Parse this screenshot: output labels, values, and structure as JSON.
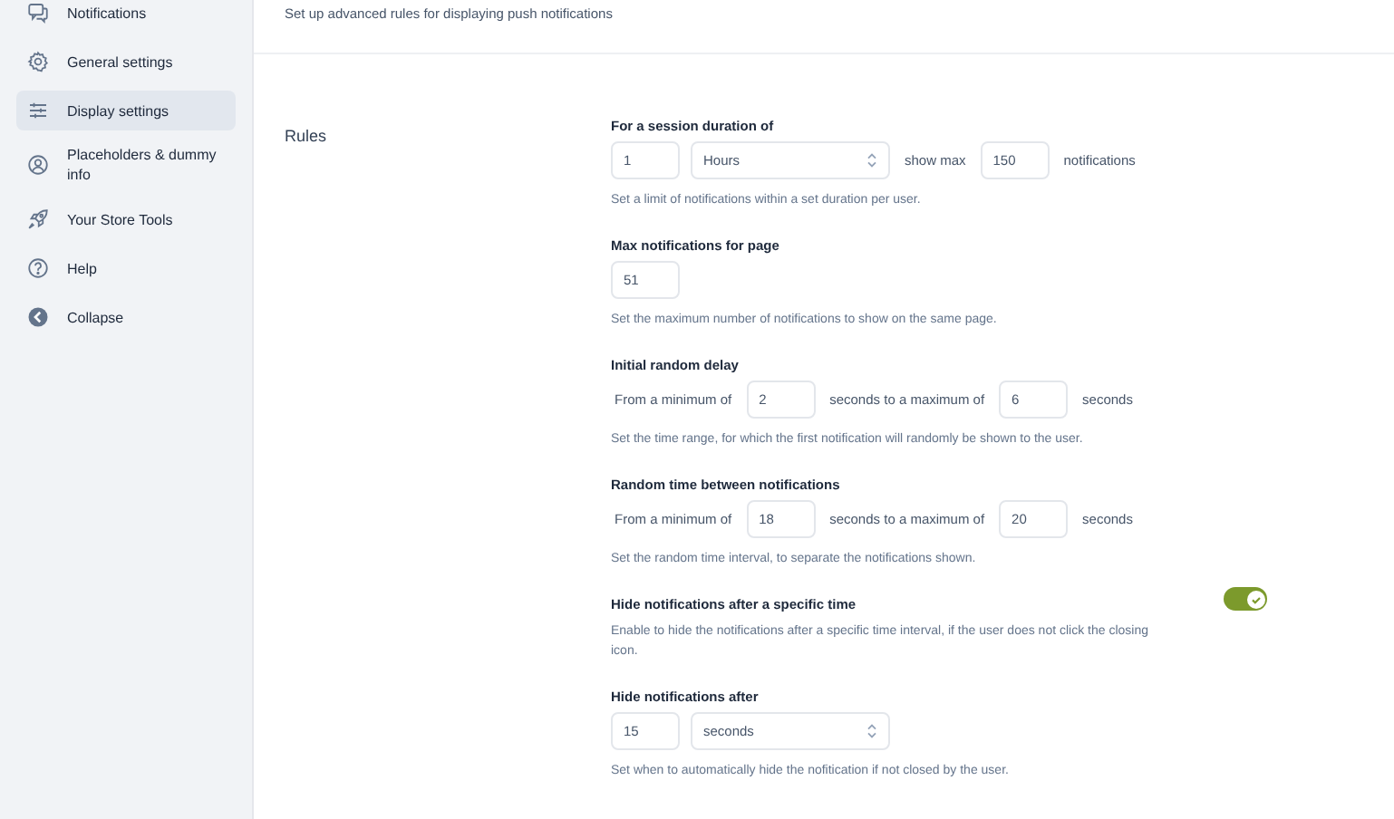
{
  "sidebar": {
    "items": [
      {
        "label": "Notifications",
        "selected": false
      },
      {
        "label": "General settings",
        "selected": false
      },
      {
        "label": "Display settings",
        "selected": true
      },
      {
        "label": "Placeholders & dummy info",
        "selected": false
      },
      {
        "label": "Your Store Tools",
        "selected": false
      },
      {
        "label": "Help",
        "selected": false
      },
      {
        "label": "Collapse",
        "selected": false
      }
    ]
  },
  "header": {
    "subtitle": "Set up advanced rules for displaying push notifications"
  },
  "section": {
    "title": "Rules",
    "settings": [
      {
        "kind": "fields",
        "title": "For a session duration of",
        "parts": [
          {
            "kind": "input",
            "value": "1"
          },
          {
            "kind": "select",
            "value": "Hours"
          },
          {
            "kind": "text",
            "text": "show max"
          },
          {
            "kind": "input",
            "value": "150"
          },
          {
            "kind": "text",
            "text": "notifications"
          }
        ],
        "help": "Set a limit of notifications within a set duration per user."
      },
      {
        "kind": "fields",
        "title": "Max notifications for page",
        "parts": [
          {
            "kind": "input",
            "value": "51"
          }
        ],
        "help": "Set the maximum number of notifications to show on the same page."
      },
      {
        "kind": "fields",
        "title": "Initial random delay",
        "parts": [
          {
            "kind": "text",
            "text": "From a minimum of"
          },
          {
            "kind": "input",
            "value": "2"
          },
          {
            "kind": "text",
            "text": "seconds to a maximum of"
          },
          {
            "kind": "input",
            "value": "6"
          },
          {
            "kind": "text",
            "text": "seconds"
          }
        ],
        "help": "Set the time range, for which the first notification will randomly be shown to the user."
      },
      {
        "kind": "fields",
        "title": "Random time between notifications",
        "parts": [
          {
            "kind": "text",
            "text": "From a minimum of"
          },
          {
            "kind": "input",
            "value": "18"
          },
          {
            "kind": "text",
            "text": "seconds to a maximum of"
          },
          {
            "kind": "input",
            "value": "20"
          },
          {
            "kind": "text",
            "text": "seconds"
          }
        ],
        "help": "Set the random time interval, to separate the notifications shown."
      },
      {
        "kind": "toggle",
        "title": "Hide notifications after a specific time",
        "on": true,
        "help": "Enable to hide the notifications after a specific time interval, if the user does not click the closing icon."
      },
      {
        "kind": "fields",
        "title": "Hide notifications after",
        "parts": [
          {
            "kind": "input",
            "value": "15"
          },
          {
            "kind": "select",
            "value": "seconds"
          }
        ],
        "help": "Set when to automatically hide the nofitication if not closed by the user."
      }
    ]
  }
}
